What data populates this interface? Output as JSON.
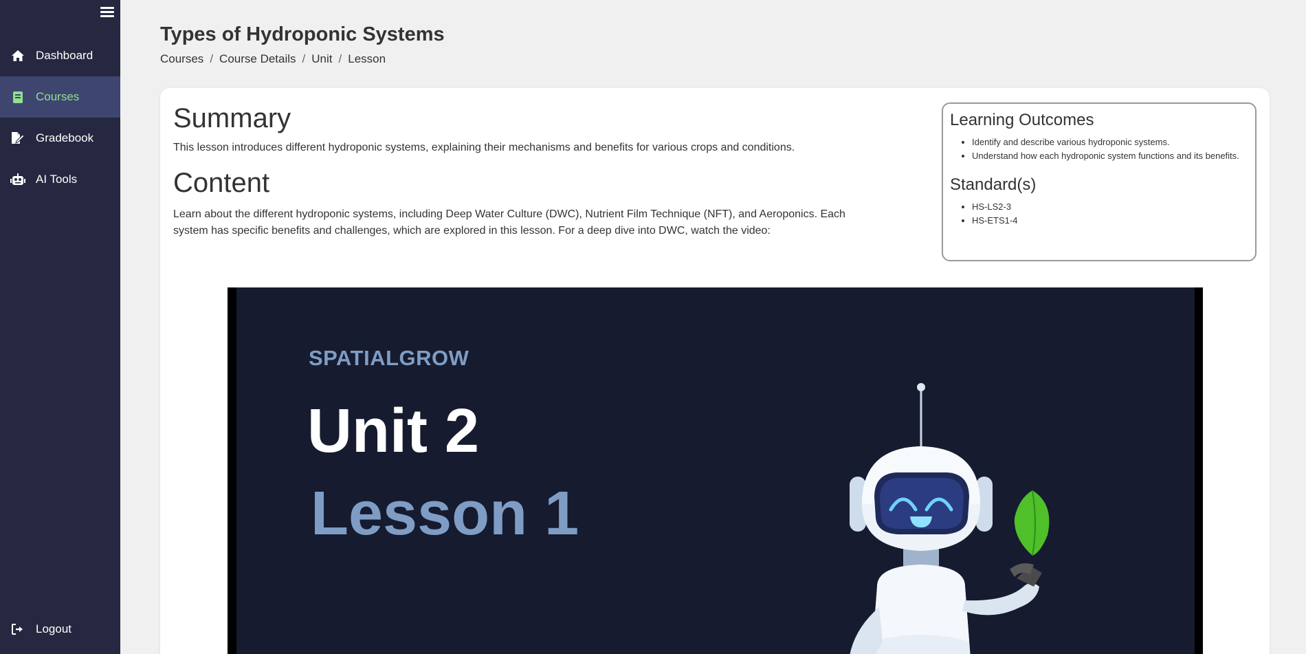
{
  "sidebar": {
    "menu_icon": "hamburger-icon",
    "items": [
      {
        "label": "Dashboard",
        "icon": "home-icon"
      },
      {
        "label": "Courses",
        "icon": "book-icon",
        "active": true
      },
      {
        "label": "Gradebook",
        "icon": "gradebook-icon"
      },
      {
        "label": "AI Tools",
        "icon": "robot-icon"
      }
    ],
    "logout": {
      "label": "Logout",
      "icon": "logout-icon"
    },
    "active_color": "#8fe08f"
  },
  "header": {
    "title": "Types of Hydroponic Systems",
    "breadcrumb": [
      "Courses",
      "Course Details",
      "Unit",
      "Lesson"
    ],
    "breadcrumb_separator": "/"
  },
  "lesson": {
    "summary_heading": "Summary",
    "summary_text": "This lesson introduces different hydroponic systems, explaining their mechanisms and benefits for various crops and conditions.",
    "content_heading": "Content",
    "content_text": "Learn about the different hydroponic systems, including Deep Water Culture (DWC), Nutrient Film Technique (NFT), and Aeroponics. Each system has specific benefits and challenges, which are explored in this lesson. For a deep dive into DWC, watch the video:"
  },
  "outcomes": {
    "heading": "Learning Outcomes",
    "items": [
      "Identify and describe various hydroponic systems.",
      "Understand how each hydroponic system functions and its benefits."
    ],
    "standards_heading": "Standard(s)",
    "standards": [
      "HS-LS2-3",
      "HS-ETS1-4"
    ]
  },
  "video": {
    "brand": "SPATIALGROW",
    "unit": "Unit 2",
    "lesson": "Lesson 1",
    "background": "#161b30"
  }
}
